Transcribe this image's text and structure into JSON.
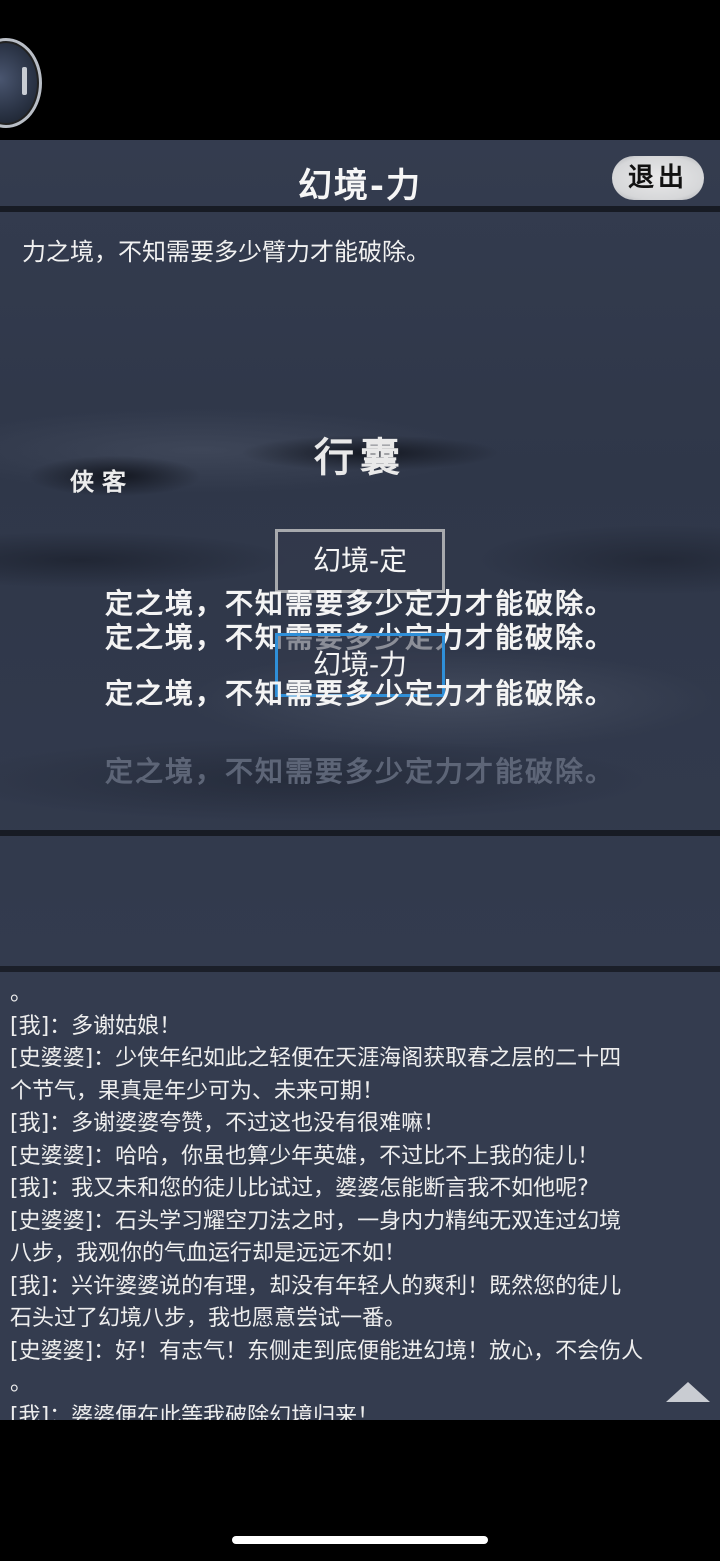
{
  "header": {
    "title": "幻境-力",
    "exit_label": "退出"
  },
  "description": "力之境，不知需要多少臂力才能破除。",
  "background": {
    "bag_title": "行囊",
    "hero_label": "侠客"
  },
  "options": [
    {
      "label": "幻境-定"
    },
    {
      "label": "幻境-力"
    }
  ],
  "floating_lines": [
    "定之境，不知需要多少定力才能破除。",
    "定之境，不知需要多少定力才能破除。",
    "定之境，不知需要多少定力才能破除。",
    "定之境，不知需要多少定力才能破除。"
  ],
  "chat_log": [
    "。",
    "[我]：多谢姑娘！",
    "[史婆婆]：少侠年纪如此之轻便在天涯海阁获取春之层的二十四",
    "个节气，果真是年少可为、未来可期！",
    "[我]：多谢婆婆夸赞，不过这也没有很难嘛！",
    "[史婆婆]：哈哈，你虽也算少年英雄，不过比不上我的徒儿！",
    "[我]：我又未和您的徒儿比试过，婆婆怎能断言我不如他呢?",
    "[史婆婆]：石头学习耀空刀法之时，一身内力精纯无双连过幻境",
    "八步，我观你的气血运行却是远远不如！",
    "[我]：兴许婆婆说的有理，却没有年轻人的爽利！既然您的徒儿",
    "石头过了幻境八步，我也愿意尝试一番。",
    "[史婆婆]：好！有志气！东侧走到底便能进幻境！放心，不会伤人",
    "。",
    "[我]：婆婆便在此等我破除幻境归来！"
  ]
}
